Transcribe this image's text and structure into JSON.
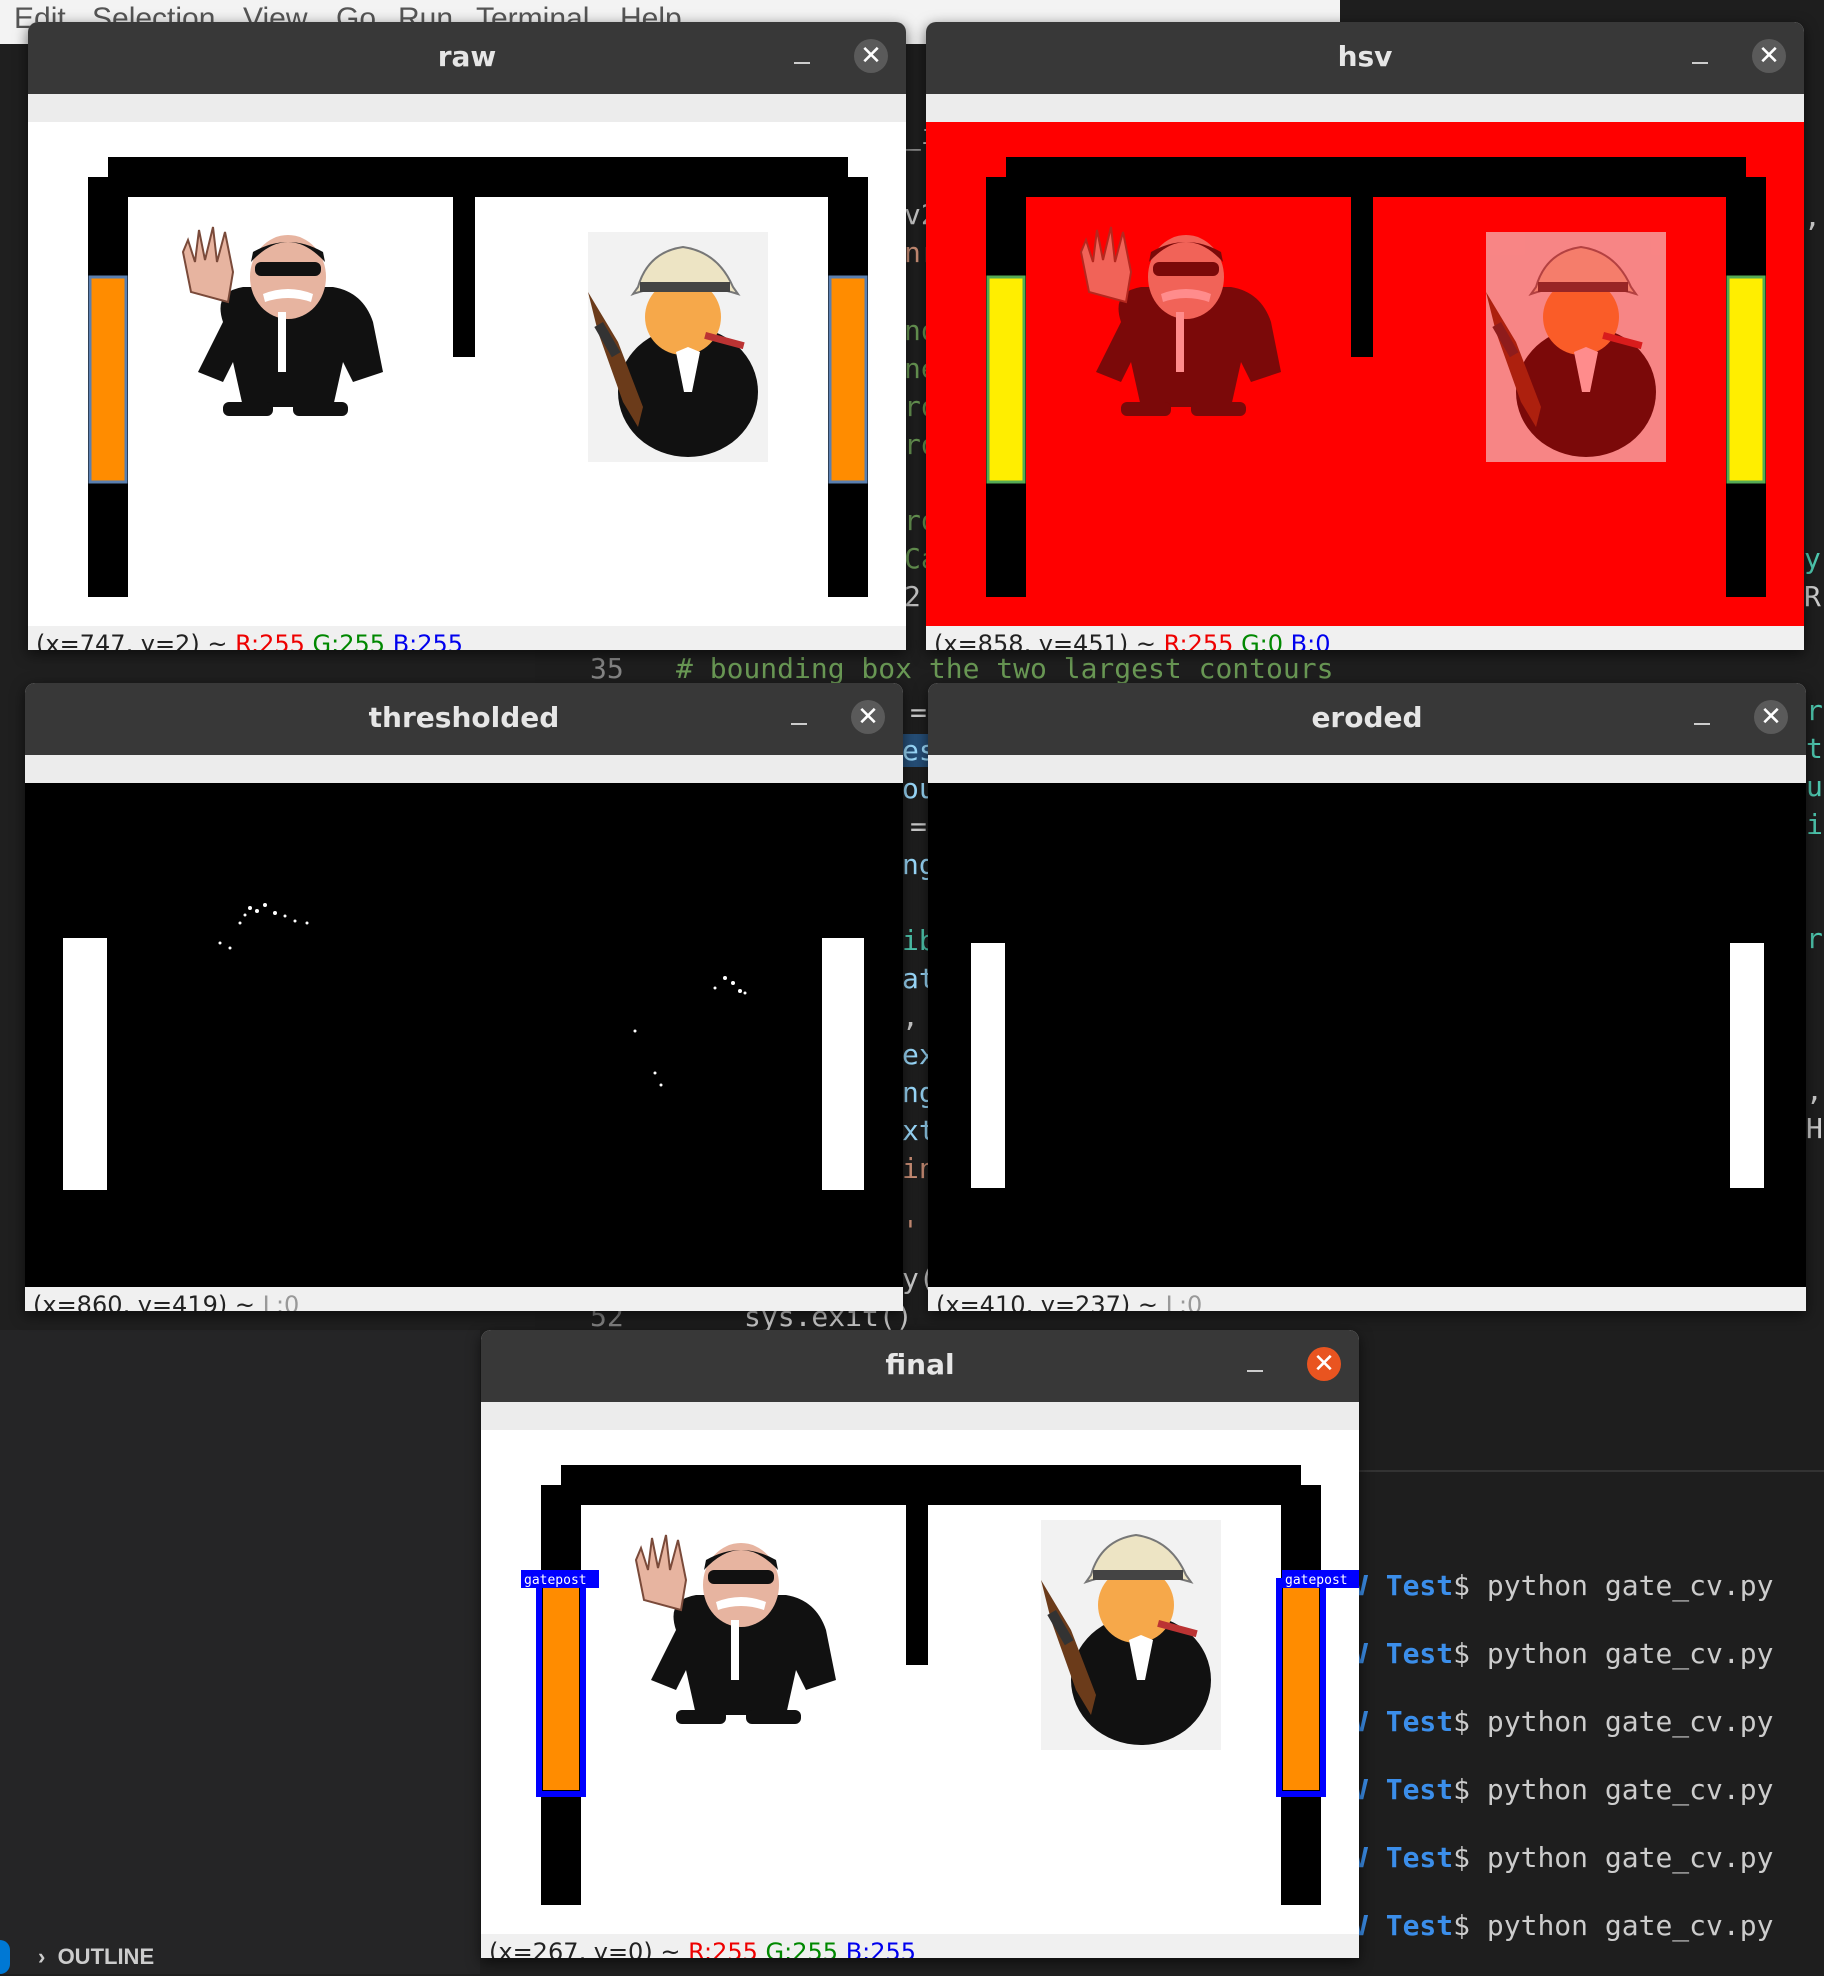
{
  "menubar": {
    "items": [
      "Edit",
      "Selection",
      "View",
      "Go",
      "Run",
      "Terminal",
      "Help"
    ]
  },
  "editor": {
    "line35": {
      "number": "35",
      "comment": "# bounding box the two largest contours"
    },
    "line52": {
      "number": "52",
      "code": "sys.exit()"
    },
    "edge_fragments": [
      "_in",
      "v2",
      "nr",
      "no",
      "ne",
      "ro",
      "ro",
      "ro",
      "Ca",
      "2.",
      "=",
      "es",
      "ou",
      "=",
      "ng",
      "ib",
      "at",
      ",",
      "ex",
      "ng",
      "xt",
      "in",
      "'",
      "y(",
      ",",
      "y",
      "R",
      "r",
      "t",
      "u",
      "i",
      "r",
      ",",
      "H"
    ]
  },
  "terminal": {
    "user_suffix": "V",
    "dir": "Test",
    "prompt": "$",
    "command": "python gate_cv.py",
    "line_count": 6
  },
  "sidebar": {
    "outline_label": "OUTLINE"
  },
  "windows": {
    "raw": {
      "title": "raw",
      "status": {
        "coords": "(x=747, y=2) ~ ",
        "r": "R:255",
        "g": "G:255",
        "b": "B:255"
      }
    },
    "hsv": {
      "title": "hsv",
      "status": {
        "coords": "(x=858, y=451) ~ ",
        "r": "R:255",
        "g": "G:0",
        "b": "B:0"
      }
    },
    "thresholded": {
      "title": "thresholded",
      "status": {
        "coords": "(x=860, y=419) ~ ",
        "l": "L:0"
      }
    },
    "eroded": {
      "title": "eroded",
      "status": {
        "coords": "(x=410, y=237) ~ ",
        "l": "L:0"
      }
    },
    "final": {
      "title": "final",
      "status": {
        "coords": "(x=267, y=0) ~ ",
        "r": "R:255",
        "g": "G:255",
        "b": "B:255"
      },
      "label_left": "gatepost",
      "label_right": "gatepost"
    }
  },
  "colors": {
    "gate_orange": "#ff8c00",
    "hsv_red": "#ff0000",
    "hsv_yellow": "#ffee00",
    "box_blue": "#0000ff",
    "close_red": "#e95420"
  },
  "icons": [
    "minimize-icon",
    "close-icon",
    "chevron-right-icon"
  ]
}
